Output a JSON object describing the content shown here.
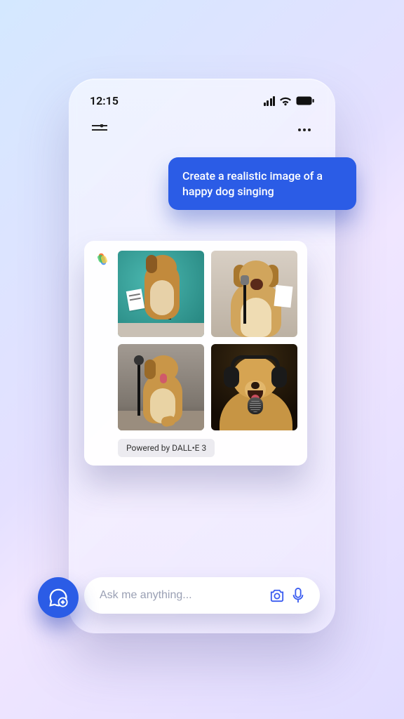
{
  "status": {
    "time": "12:15"
  },
  "chat": {
    "user_prompt": "Create a realistic image of a happy dog singing",
    "powered_by": "Powered by DALL•E 3"
  },
  "input": {
    "placeholder": "Ask me anything..."
  },
  "colors": {
    "accent": "#2b5ce6"
  }
}
